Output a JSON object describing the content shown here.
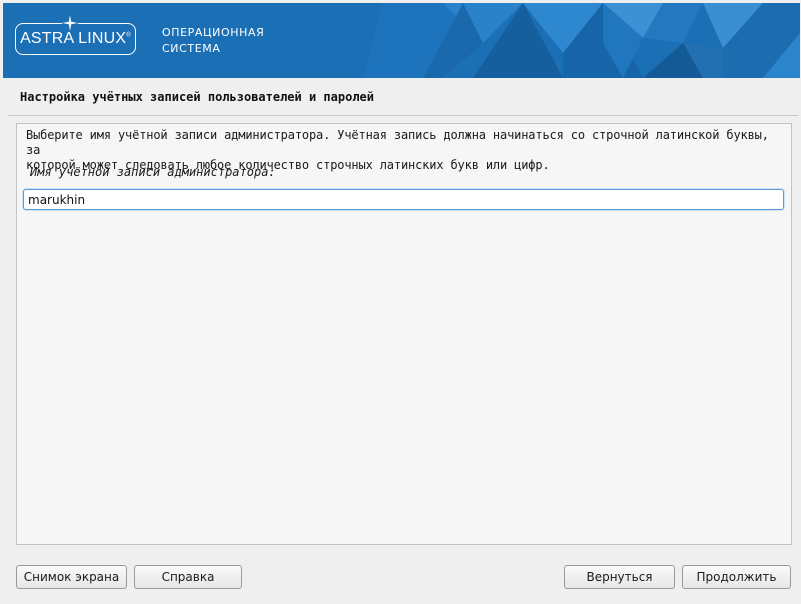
{
  "header": {
    "logo_text": "ASTRA LINUX",
    "logo_mark": "®",
    "subtitle_line1": "ОПЕРАЦИОННАЯ",
    "subtitle_line2": "СИСТЕМА",
    "brand_color": "#1b6fb5"
  },
  "page": {
    "title": "Настройка учётных записей пользователей и паролей"
  },
  "form": {
    "description_line1": "Выберите имя учётной записи администратора. Учётная запись должна начинаться со строчной латинской буквы, за",
    "description_line2": "которой может следовать любое количество строчных латинских букв или цифр.",
    "field_label": "Имя учётной записи администратора:",
    "username_value": "marukhin"
  },
  "buttons": {
    "screenshot": "Снимок экрана",
    "help": "Справка",
    "back": "Вернуться",
    "continue": "Продолжить"
  }
}
